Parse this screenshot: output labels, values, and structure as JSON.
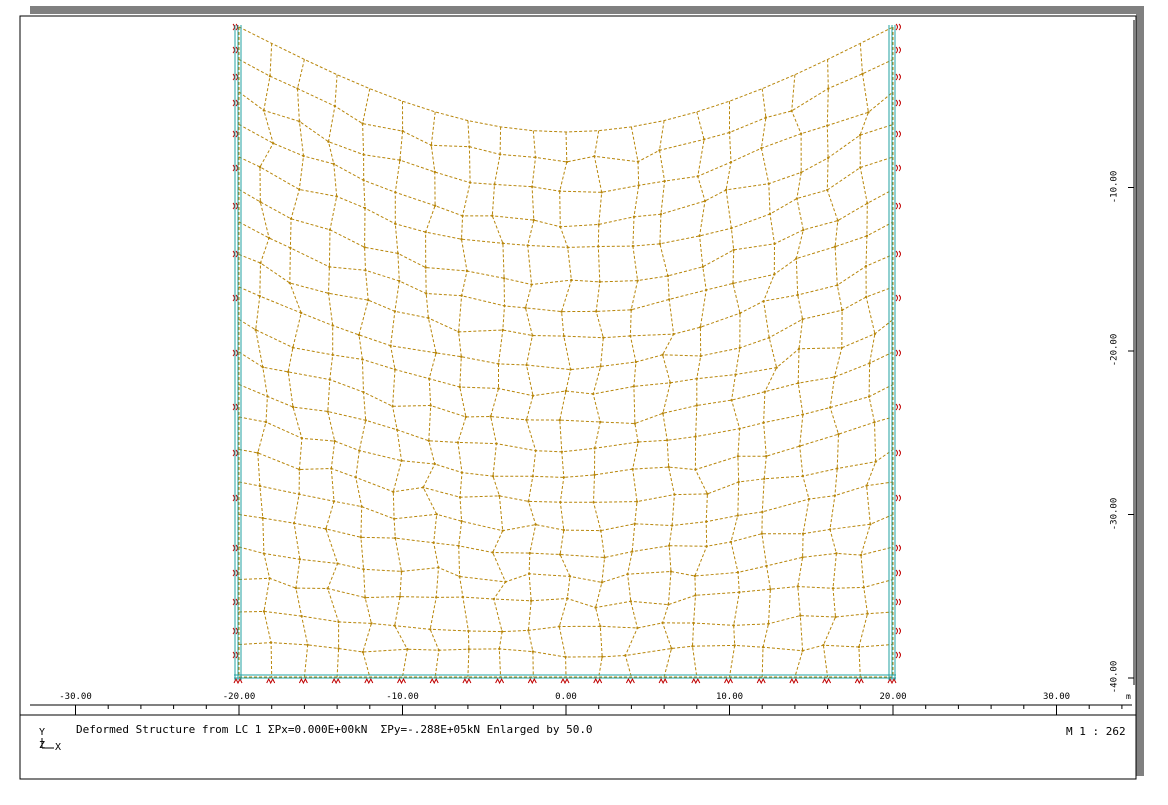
{
  "x_ticks": [
    "-30.00",
    "-20.00",
    "-10.00",
    "0.00",
    "10.00",
    "20.00",
    "30.00"
  ],
  "y_ticks": [
    "-10.00",
    "-20.00",
    "-30.00",
    "-40.00"
  ],
  "unit": "m",
  "caption": "Deformed Structure from LC 1 ΣPx=0.000E+00kN  ΣPy=-.288E+05kN Enlarged by 50.0",
  "scale": "M 1 : 262",
  "axis_icon": {
    "y": "Y",
    "z": "Z",
    "x": "X"
  },
  "colors": {
    "mesh": "#b8860b",
    "boundary": "#20a0a0",
    "support": "#c00000",
    "frame": "#808080"
  }
}
